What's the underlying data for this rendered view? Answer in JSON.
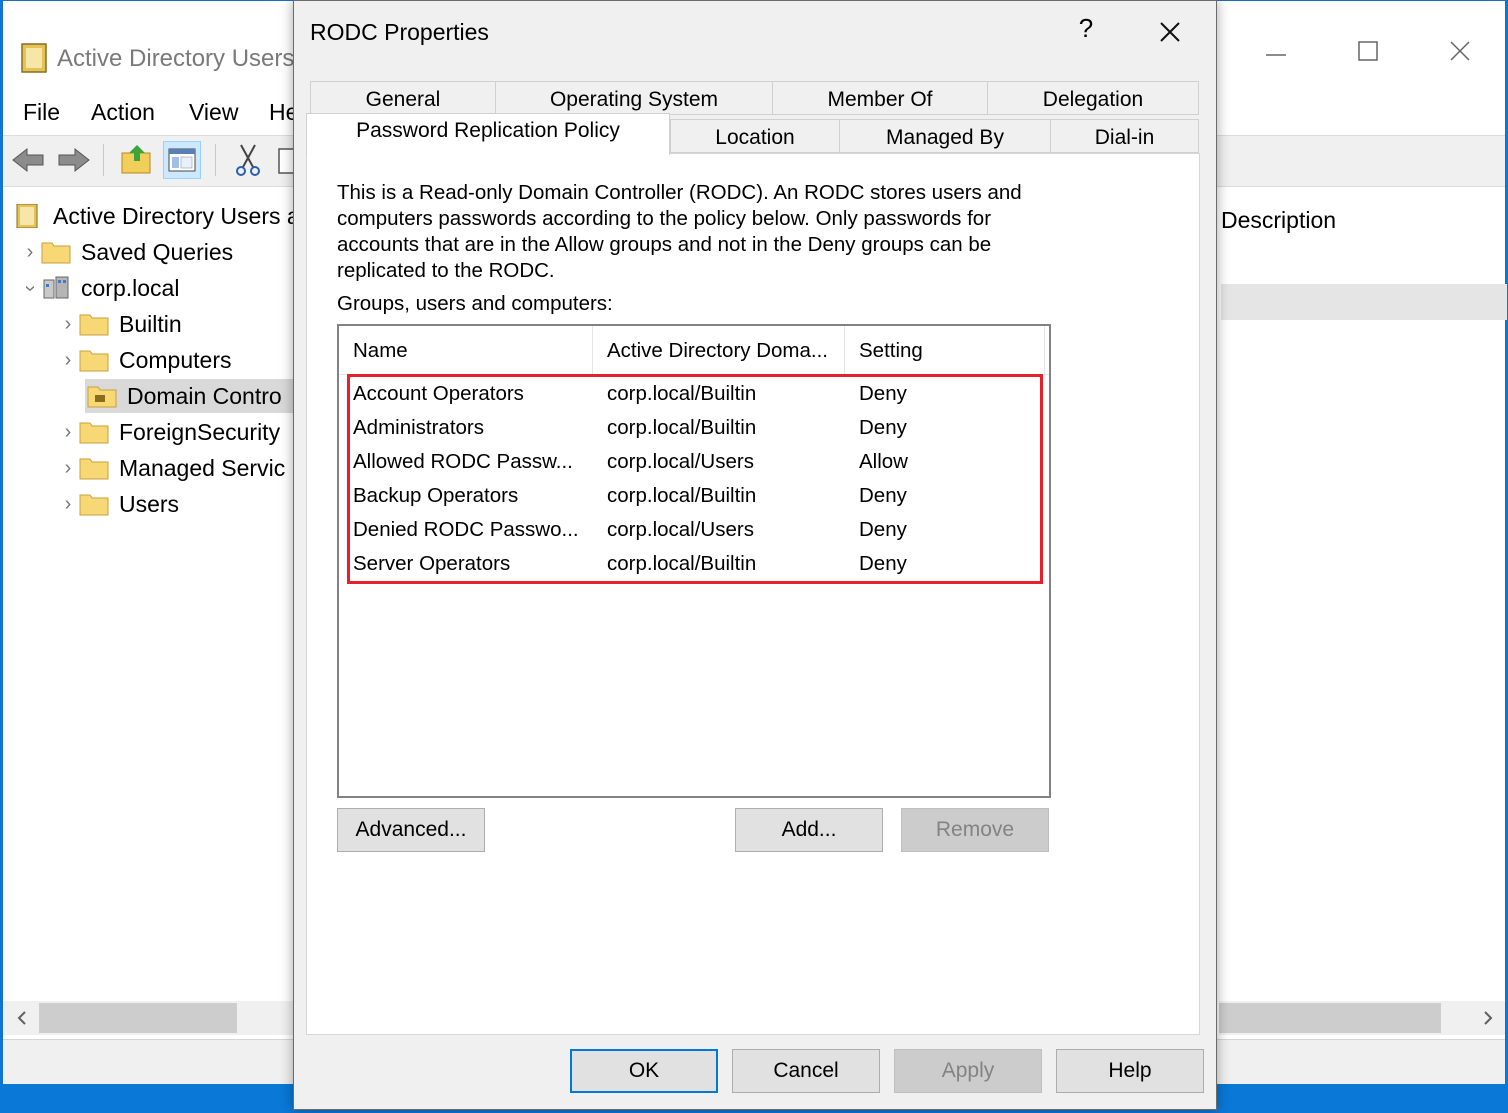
{
  "mmc": {
    "title": "Active Directory Users",
    "menu": [
      "File",
      "Action",
      "View",
      "He"
    ],
    "tree": [
      {
        "label": "Active Directory Users a",
        "level": 0,
        "expander": "none",
        "icon": "aduc-icon"
      },
      {
        "label": "Saved Queries",
        "level": 1,
        "expander": "collapsed",
        "icon": "folder-icon"
      },
      {
        "label": "corp.local",
        "level": 1,
        "expander": "expanded",
        "icon": "domain-icon"
      },
      {
        "label": "Builtin",
        "level": 2,
        "expander": "collapsed",
        "icon": "folder-icon"
      },
      {
        "label": "Computers",
        "level": 2,
        "expander": "collapsed",
        "icon": "folder-icon"
      },
      {
        "label": "Domain Contro",
        "level": 2,
        "expander": "none",
        "icon": "ou-folder-icon",
        "selected": true
      },
      {
        "label": "ForeignSecurity",
        "level": 2,
        "expander": "collapsed",
        "icon": "folder-icon"
      },
      {
        "label": "Managed Servic",
        "level": 2,
        "expander": "collapsed",
        "icon": "folder-icon"
      },
      {
        "label": "Users",
        "level": 2,
        "expander": "collapsed",
        "icon": "folder-icon"
      }
    ],
    "right_header": "Description"
  },
  "dialog": {
    "title": "RODC Properties",
    "help_glyph": "?",
    "tabs_row1": [
      "General",
      "Operating System",
      "Member Of",
      "Delegation"
    ],
    "tabs_row2": [
      "Password Replication Policy",
      "Location",
      "Managed By",
      "Dial-in"
    ],
    "active_tab": "Password Replication Policy",
    "description": "This is a Read-only Domain Controller (RODC).  An RODC stores users and computers passwords according to the policy below.  Only passwords for accounts that are in the Allow groups and not in the Deny groups can be replicated to the RODC.",
    "list_label": "Groups, users and computers:",
    "columns": [
      "Name",
      "Active Directory Doma...",
      "Setting"
    ],
    "rows": [
      [
        "Account Operators",
        "corp.local/Builtin",
        "Deny"
      ],
      [
        "Administrators",
        "corp.local/Builtin",
        "Deny"
      ],
      [
        "Allowed RODC Passw...",
        "corp.local/Users",
        "Allow"
      ],
      [
        "Backup Operators",
        "corp.local/Builtin",
        "Deny"
      ],
      [
        "Denied RODC Passwo...",
        "corp.local/Users",
        "Deny"
      ],
      [
        "Server Operators",
        "corp.local/Builtin",
        "Deny"
      ]
    ],
    "buttons": {
      "advanced": "Advanced...",
      "add": "Add...",
      "remove": "Remove",
      "ok": "OK",
      "cancel": "Cancel",
      "apply": "Apply",
      "help": "Help"
    },
    "highlight_color": "#e8202a",
    "accent_color": "#0078d7"
  }
}
